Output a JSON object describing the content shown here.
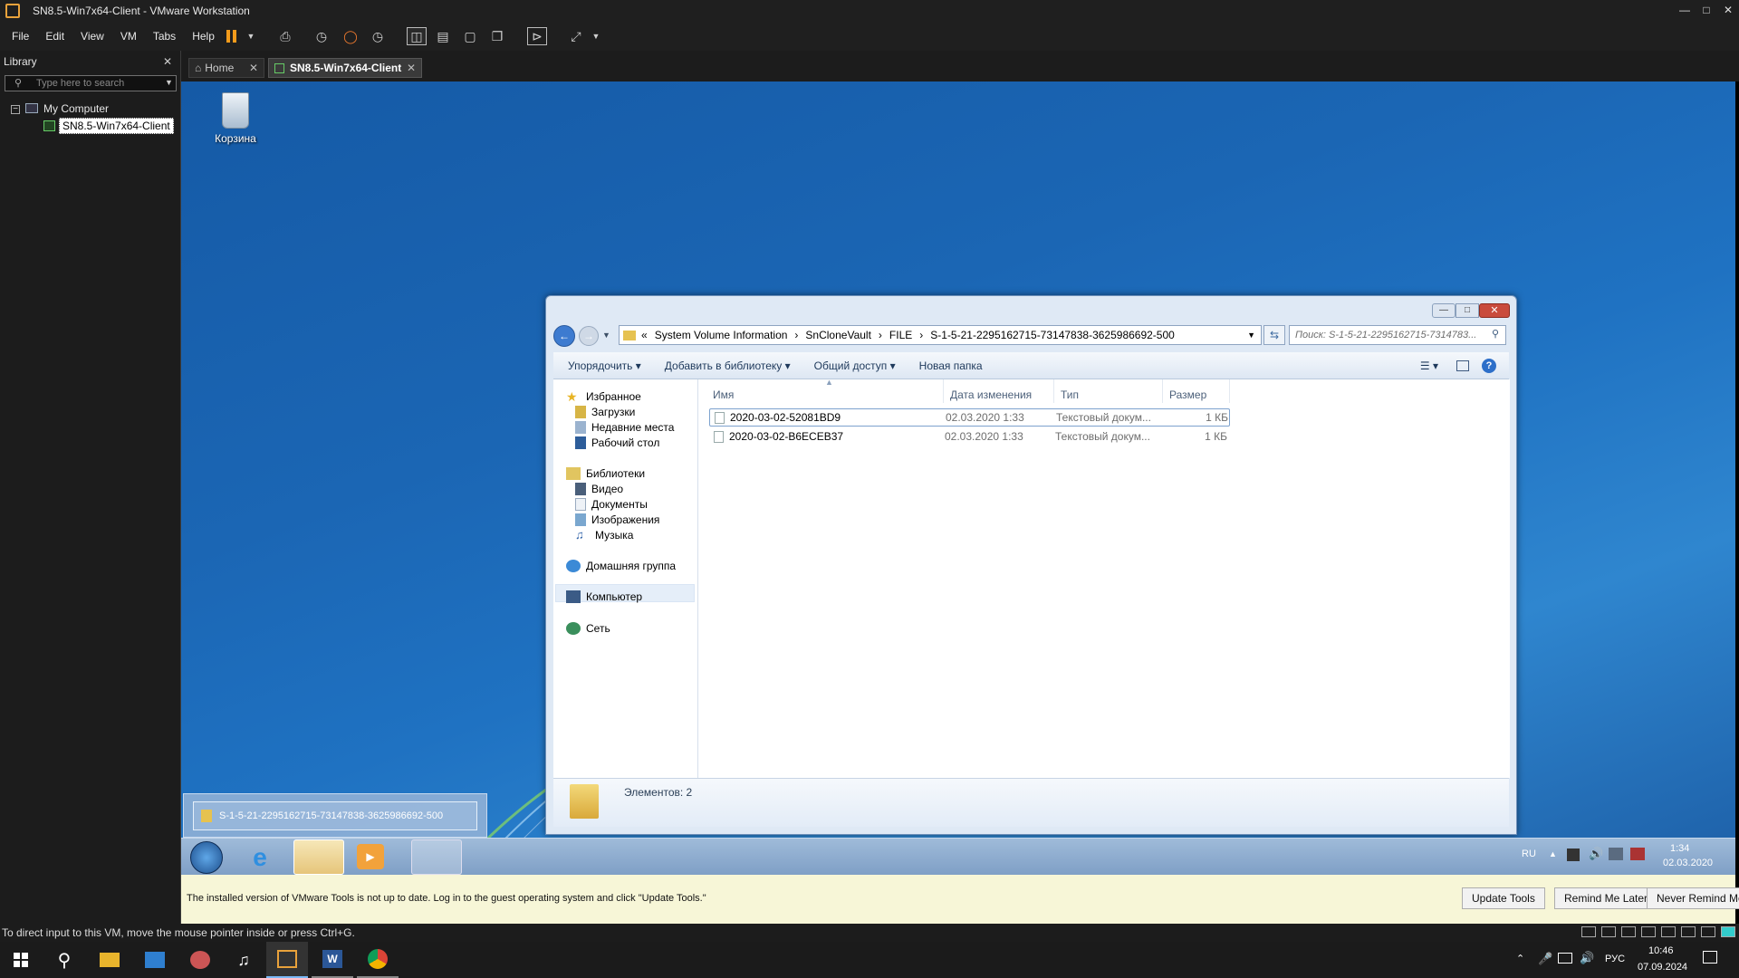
{
  "app": {
    "title": "SN8.5-Win7x64-Client - VMware Workstation"
  },
  "menu": [
    "File",
    "Edit",
    "View",
    "VM",
    "Tabs",
    "Help"
  ],
  "library": {
    "title": "Library",
    "search_placeholder": "Type here to search",
    "tree_root": "My Computer",
    "tree_child": "SN8.5-Win7x64-Client"
  },
  "tabs": {
    "home": "Home",
    "vm": "SN8.5-Win7x64-Client"
  },
  "desktop": {
    "recycle_label": "Корзина"
  },
  "explorer": {
    "breadcrumb": [
      "«",
      "System Volume Information",
      "›",
      "SnCloneVault",
      "›",
      "FILE",
      "›",
      "S-1-5-21-2295162715-73147838-3625986692-500"
    ],
    "search_placeholder": "Поиск: S-1-5-21-2295162715-7314783...",
    "commands": {
      "organize": "Упорядочить",
      "add_library": "Добавить в библиотеку",
      "share": "Общий доступ",
      "new_folder": "Новая папка"
    },
    "nav": {
      "favorites": "Избранное",
      "downloads": "Загрузки",
      "recent": "Недавние места",
      "desktop": "Рабочий стол",
      "libraries": "Библиотеки",
      "video": "Видео",
      "documents": "Документы",
      "images": "Изображения",
      "music": "Музыка",
      "homegroup": "Домашняя группа",
      "computer": "Компьютер",
      "network": "Сеть"
    },
    "columns": {
      "name": "Имя",
      "date": "Дата изменения",
      "type": "Тип",
      "size": "Размер"
    },
    "files": [
      {
        "name": "2020-03-02-52081BD9",
        "date": "02.03.2020 1:33",
        "type": "Текстовый докум...",
        "size": "1 КБ"
      },
      {
        "name": "2020-03-02-B6ECEB37",
        "date": "02.03.2020 1:33",
        "type": "Текстовый докум...",
        "size": "1 КБ"
      }
    ],
    "status": "Элементов: 2"
  },
  "guest_taskbar": {
    "preview_title": "S-1-5-21-2295162715-73147838-3625986692-500",
    "lang": "RU",
    "time": "1:34",
    "date": "02.03.2020"
  },
  "notify": {
    "message": "The installed version of VMware Tools is not up to date. Log in to the guest operating system and click \"Update Tools.\"",
    "update": "Update Tools",
    "remind_later": "Remind Me Later",
    "never_remind": "Never Remind Me"
  },
  "statusbar": {
    "text": "To direct input to this VM, move the mouse pointer inside or press Ctrl+G."
  },
  "host_taskbar": {
    "lang": "РУС",
    "time": "10:46",
    "date": "07.09.2024"
  }
}
